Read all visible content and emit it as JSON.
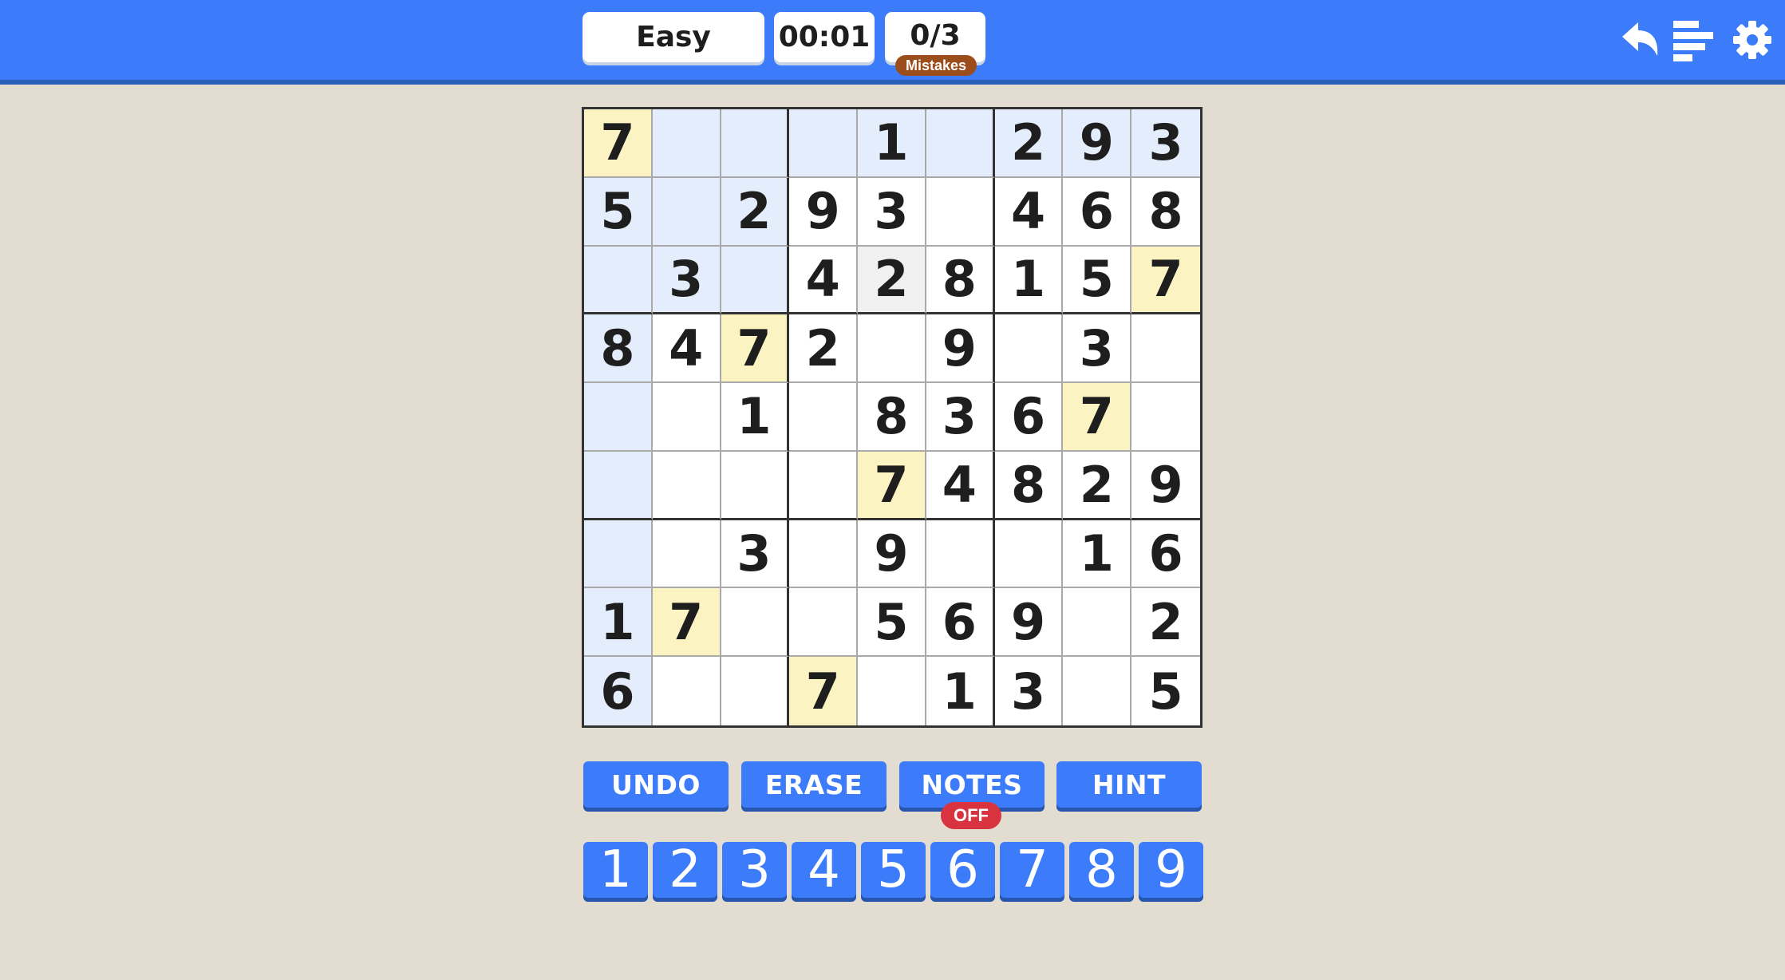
{
  "header": {
    "difficulty": "Easy",
    "timer": "00:01",
    "mistakes": "0/3",
    "mistakes_label": "Mistakes",
    "icons": [
      "back-arrow-icon",
      "stats-icon",
      "gear-icon"
    ]
  },
  "board": {
    "cells": [
      [
        "7",
        "",
        "",
        "",
        "1",
        "",
        "2",
        "9",
        "3"
      ],
      [
        "5",
        "",
        "2",
        "9",
        "3",
        "",
        "4",
        "6",
        "8"
      ],
      [
        "",
        "3",
        "",
        "4",
        "2",
        "8",
        "1",
        "5",
        "7"
      ],
      [
        "8",
        "4",
        "7",
        "2",
        "",
        "9",
        "",
        "3",
        ""
      ],
      [
        "",
        "",
        "1",
        "",
        "8",
        "3",
        "6",
        "7",
        ""
      ],
      [
        "",
        "",
        "",
        "",
        "7",
        "4",
        "8",
        "2",
        "9"
      ],
      [
        "",
        "",
        "3",
        "",
        "9",
        "",
        "",
        "1",
        "6"
      ],
      [
        "1",
        "7",
        "",
        "",
        "5",
        "6",
        "9",
        "",
        "2"
      ],
      [
        "6",
        "",
        "",
        "7",
        "",
        "1",
        "3",
        "",
        "5"
      ]
    ],
    "selected_value": "7",
    "selected_cell": [
      0,
      0
    ],
    "highlight_color": "#e3edfb",
    "same_number_color": "#fbf4c2"
  },
  "actions": {
    "undo": "UNDO",
    "erase": "ERASE",
    "notes": "NOTES",
    "notes_state": "OFF",
    "hint": "HINT"
  },
  "numpad": [
    "1",
    "2",
    "3",
    "4",
    "5",
    "6",
    "7",
    "8",
    "9"
  ],
  "colors": {
    "accent": "#3c7cfa",
    "background": "#e3dcd1",
    "mistakes_badge": "#9c4d1c",
    "notes_off_badge": "#d8333e"
  }
}
